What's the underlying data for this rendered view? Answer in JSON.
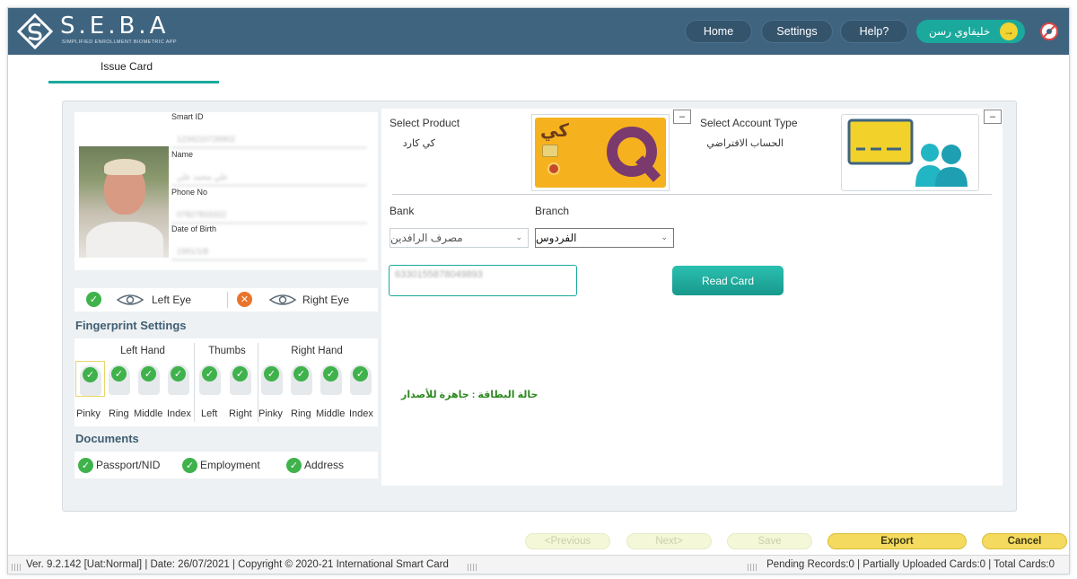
{
  "app": {
    "logo_text": "S.E.B.A",
    "logo_subtitle": "SIMPLIFIED ENROLLMENT BIOMETRIC APP"
  },
  "nav": {
    "home": "Home",
    "settings": "Settings",
    "help": "Help?",
    "user_name": "خليفاوي رسن"
  },
  "tab": {
    "label": "Issue Card"
  },
  "profile": {
    "smart_id_label": "Smart ID",
    "smart_id_value": "1234210726902",
    "name_label": "Name",
    "name_value": "علي محمد علي",
    "phone_label": "Phone No",
    "phone_value": "07827833322",
    "dob_label": "Date of Birth",
    "dob_value": "1991/1/8"
  },
  "eyes": {
    "left": "Left Eye",
    "right": "Right Eye"
  },
  "fingerprint": {
    "title": "Fingerprint Settings",
    "groups": [
      "Left Hand",
      "Thumbs",
      "Right Hand"
    ],
    "fingers": [
      "Pinky",
      "Ring",
      "Middle",
      "Index",
      "Left",
      "Right",
      "Pinky",
      "Ring",
      "Middle",
      "Index"
    ]
  },
  "documents": {
    "title": "Documents",
    "items": [
      "Passport/NID",
      "Employment",
      "Address"
    ]
  },
  "product": {
    "label": "Select Product",
    "value": "كي كارد",
    "card_brand": "كي"
  },
  "account": {
    "label": "Select Account Type",
    "value": "الحساب الافتراضي"
  },
  "bank": {
    "label": "Bank",
    "value": "مصرف الرافدين"
  },
  "branch": {
    "label": "Branch",
    "value": "الفردوس"
  },
  "card_number": {
    "value": "6330155878049893"
  },
  "read_card_label": "Read Card",
  "card_status": "حالة البطاقة : جاهزة للأصدار",
  "collapse_symbol": "–",
  "buttons": {
    "previous": "<Previous",
    "next": "Next>",
    "save": "Save",
    "export": "Export",
    "cancel": "Cancel"
  },
  "statusbar": {
    "left": "Ver. 9.2.142 [Uat:Normal] | Date: 26/07/2021 | Copyright © 2020-21 International Smart Card",
    "right": "Pending Records:0 | Partially Uploaded Cards:0 | Total Cards:0"
  },
  "colors": {
    "header": "#3f6480",
    "accent": "#1aa99c",
    "yellow": "#f4da5e",
    "success": "#3fb24b",
    "warning": "#e9742b"
  }
}
